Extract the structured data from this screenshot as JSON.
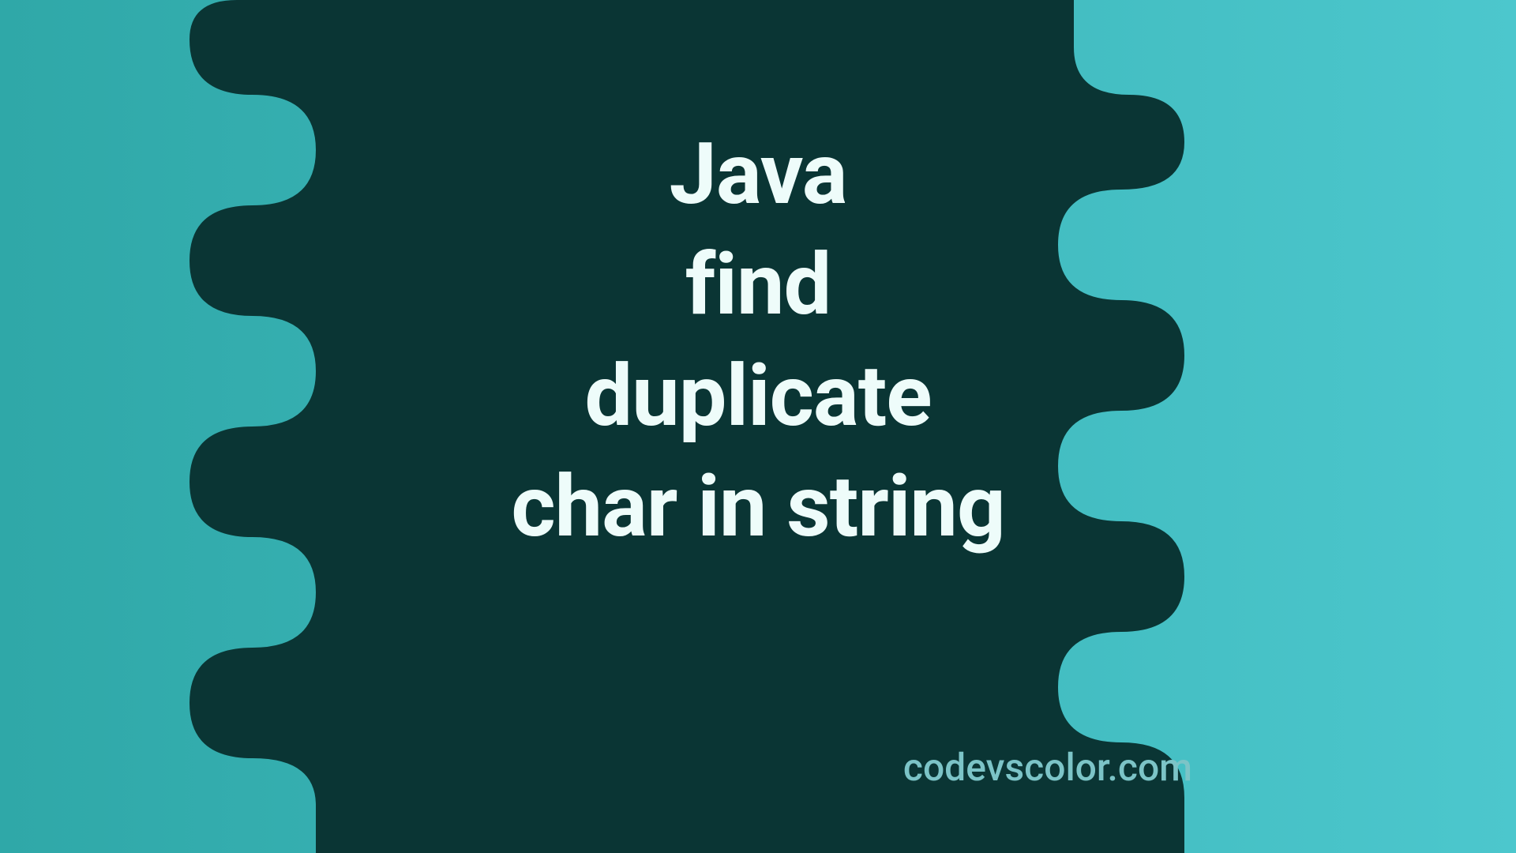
{
  "banner": {
    "title_line1": "Java",
    "title_line2": "find",
    "title_line3": "duplicate",
    "title_line4": "char in string",
    "footer_text": "codevscolor.com"
  },
  "colors": {
    "background_start": "#2fa8a8",
    "background_end": "#4cc7cd",
    "blob": "#0a3534",
    "title_text": "#eefcfa",
    "footer_text": "#7cc4c7"
  }
}
